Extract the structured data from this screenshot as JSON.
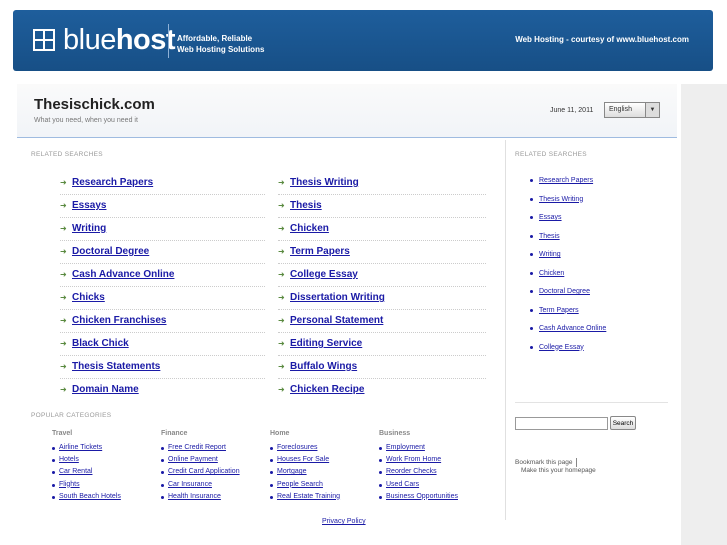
{
  "header": {
    "brand_light": "blue",
    "brand_bold": "host",
    "tagline_line1": "Affordable, Reliable",
    "tagline_line2": "Web Hosting Solutions",
    "courtesy": "Web Hosting - courtesy of www.bluehost.com"
  },
  "site": {
    "title": "Thesischick.com",
    "subtitle": "What you need, when you need it",
    "date": "June 11, 2011",
    "language": "English"
  },
  "related_label": "RELATED SEARCHES",
  "related_left": [
    "Research Papers",
    "Essays",
    "Writing",
    "Doctoral Degree",
    "Cash Advance Online",
    "Chicks",
    "Chicken Franchises",
    "Black Chick",
    "Thesis Statements",
    "Domain Name"
  ],
  "related_right": [
    "Thesis Writing",
    "Thesis",
    "Chicken",
    "Term Papers",
    "College Essay",
    "Dissertation Writing",
    "Personal Statement",
    "Editing Service",
    "Buffalo Wings",
    "Chicken Recipe"
  ],
  "side_label": "RELATED SEARCHES",
  "side_links": [
    "Research Papers",
    "Thesis Writing",
    "Essays",
    "Thesis",
    "Writing",
    "Chicken",
    "Doctoral Degree",
    "Term Papers",
    "Cash Advance Online",
    "College Essay"
  ],
  "search": {
    "button": "Search"
  },
  "bookmark": {
    "text": "Bookmark this page",
    "homepage": "Make this your homepage"
  },
  "popular_label": "POPULAR CATEGORIES",
  "categories": [
    {
      "title": "Travel",
      "items": [
        "Airline Tickets",
        "Hotels",
        "Car Rental",
        "Flights",
        "South Beach Hotels"
      ]
    },
    {
      "title": "Finance",
      "items": [
        "Free Credit Report",
        "Online Payment",
        "Credit Card Application",
        "Car Insurance",
        "Health Insurance"
      ]
    },
    {
      "title": "Home",
      "items": [
        "Foreclosures",
        "Houses For Sale",
        "Mortgage",
        "People Search",
        "Real Estate Training"
      ]
    },
    {
      "title": "Business",
      "items": [
        "Employment",
        "Work From Home",
        "Reorder Checks",
        "Used Cars",
        "Business Opportunities"
      ]
    }
  ],
  "privacy": "Privacy Policy",
  "colors": {
    "header_blue": "#1e5e9c",
    "link": "#1a1aa6",
    "arrow_green": "#5a8a40"
  },
  "icons": {
    "link_arrow": "arrow-right-icon",
    "logo": "bluehost-grid-icon",
    "dropdown": "chevron-down-icon"
  }
}
